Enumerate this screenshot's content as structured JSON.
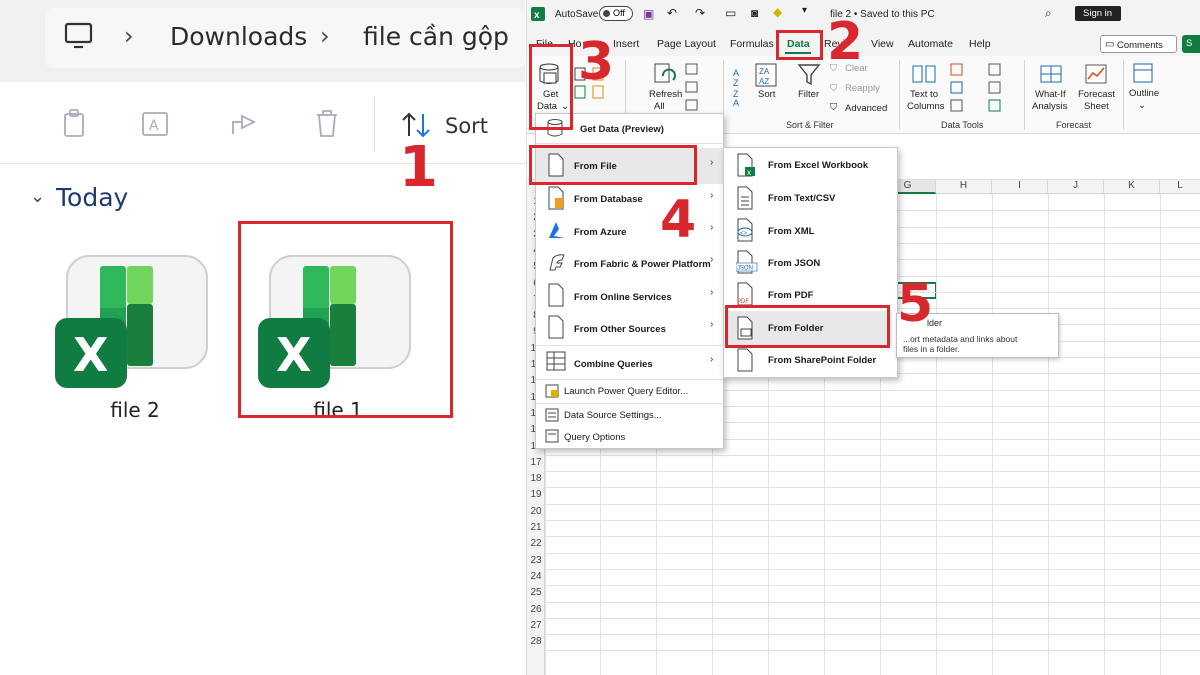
{
  "explorer": {
    "breadcrumb": [
      "Downloads",
      "file cần gộp"
    ],
    "sort_label": "Sort",
    "group_label": "Today",
    "files": [
      {
        "name": "file 2"
      },
      {
        "name": "file 1"
      }
    ],
    "icons": [
      "computer-icon",
      "copy-icon",
      "rename-icon",
      "share-icon",
      "delete-icon",
      "sort-icon",
      "excel-file-icon"
    ]
  },
  "excel": {
    "autosave_label": "AutoSave",
    "autosave_state": "Off",
    "doc_title": "file 2 • Saved to this PC",
    "sign_in": "Sign in",
    "tabs": [
      "File",
      "Ho",
      "Insert",
      "Page Layout",
      "Formulas",
      "Data",
      "Revi",
      "View",
      "Automate",
      "Help"
    ],
    "active_tab": "Data",
    "comments": "Comments",
    "share": "S",
    "ribbon": {
      "get_data": [
        "Get",
        "Data"
      ],
      "refresh_all": [
        "Refresh",
        "All"
      ],
      "sort": "Sort",
      "filter": "Filter",
      "clear": "Clear",
      "reapply": "Reapply",
      "advanced": "Advanced",
      "sort_filter_group": "Sort & Filter",
      "text_to_columns": [
        "Text to",
        "Columns"
      ],
      "data_tools_group": "Data Tools",
      "what_if": [
        "What-If",
        "Analysis"
      ],
      "forecast_sheet": [
        "Forecast",
        "Sheet"
      ],
      "forecast_group": "Forecast",
      "outline": "Outline"
    },
    "columns": [
      "G",
      "H",
      "I",
      "J",
      "K",
      "L"
    ],
    "rows": [
      "1",
      "2",
      "3",
      "4",
      "5",
      "6",
      "7",
      "8",
      "9",
      "10",
      "11",
      "12",
      "13",
      "14",
      "15",
      "16",
      "17",
      "18",
      "19",
      "20",
      "21",
      "22",
      "23",
      "24",
      "25",
      "26",
      "27",
      "28"
    ]
  },
  "get_data_menu": {
    "items": [
      {
        "label": "Get Data (Preview)",
        "icon": "database-icon"
      },
      {
        "label": "From File",
        "icon": "file-icon",
        "submenu": true
      },
      {
        "label": "From Database",
        "icon": "database-file-icon",
        "submenu": true
      },
      {
        "label": "From Azure",
        "icon": "azure-icon",
        "submenu": true
      },
      {
        "label": "From Fabric & Power Platform",
        "icon": "fabric-icon",
        "submenu": true
      },
      {
        "label": "From Online Services",
        "icon": "online-services-icon",
        "submenu": true
      },
      {
        "label": "From Other Sources",
        "icon": "other-sources-icon",
        "submenu": true
      },
      {
        "label": "Combine Queries",
        "icon": "combine-icon",
        "submenu": true
      },
      {
        "label": "Launch Power Query Editor...",
        "icon": "power-query-icon"
      },
      {
        "label": "Data Source Settings...",
        "icon": "settings-icon"
      },
      {
        "label": "Query Options",
        "icon": "options-icon"
      }
    ]
  },
  "from_file_menu": {
    "items": [
      {
        "label": "From Excel Workbook",
        "icon": "excel-workbook-icon"
      },
      {
        "label": "From Text/CSV",
        "icon": "text-csv-icon"
      },
      {
        "label": "From XML",
        "icon": "xml-icon"
      },
      {
        "label": "From JSON",
        "icon": "json-icon",
        "badge": "JSON"
      },
      {
        "label": "From PDF",
        "icon": "pdf-icon",
        "badge": "PDF"
      },
      {
        "label": "From Folder",
        "icon": "folder-icon"
      },
      {
        "label": "From SharePoint Folder",
        "icon": "sharepoint-folder-icon"
      }
    ]
  },
  "tooltip": {
    "title": "lder",
    "body": [
      "...ort metadata and links about",
      "files in a folder."
    ]
  },
  "annotations": [
    "1",
    "2",
    "3",
    "4",
    "5"
  ],
  "colors": {
    "annotation": "#d9272e",
    "excel_green": "#107c41",
    "link_blue": "#1e3a6e"
  }
}
